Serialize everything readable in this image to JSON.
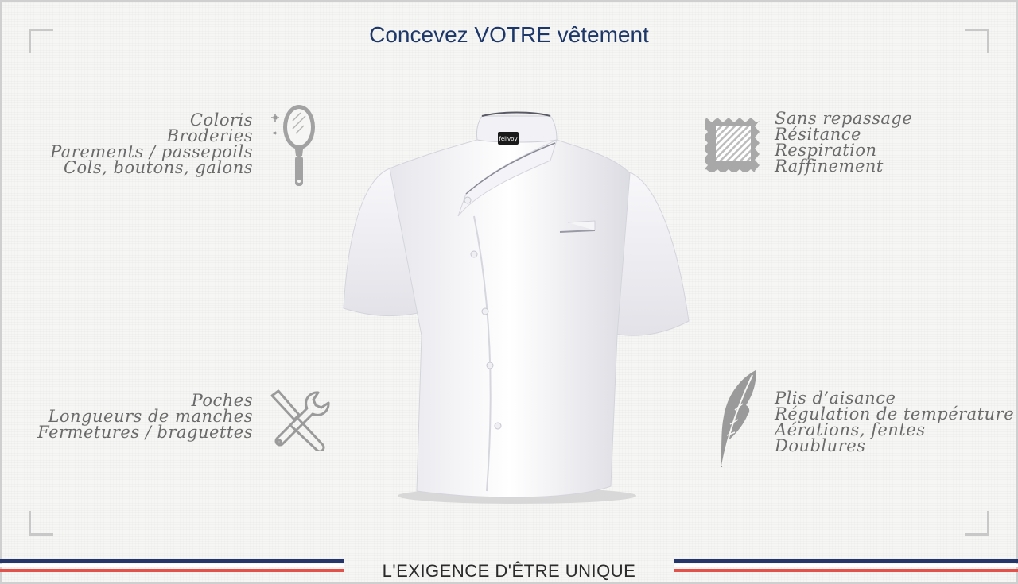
{
  "title": "Concevez VOTRE vêtement",
  "top_left": [
    "Coloris",
    "Broderies",
    "Parements / passepoils",
    "Cols, boutons, galons"
  ],
  "bottom_left": [
    "Poches",
    "Longueurs de manches",
    "Fermetures / braguettes"
  ],
  "top_right": [
    "Sans repassage",
    "Résitance",
    "Respiration",
    "Raffinement"
  ],
  "bottom_right": [
    "Plis d’aisance",
    "Régulation de température",
    "Aérations, fentes",
    "Doublures"
  ],
  "jacket_label": "fellvoy",
  "tagline": "L'EXIGENCE D'ÊTRE UNIQUE",
  "colors": {
    "title": "#1e3769",
    "blue": "#23356b",
    "red": "#e3524a",
    "icon": "#9a9a9a"
  }
}
